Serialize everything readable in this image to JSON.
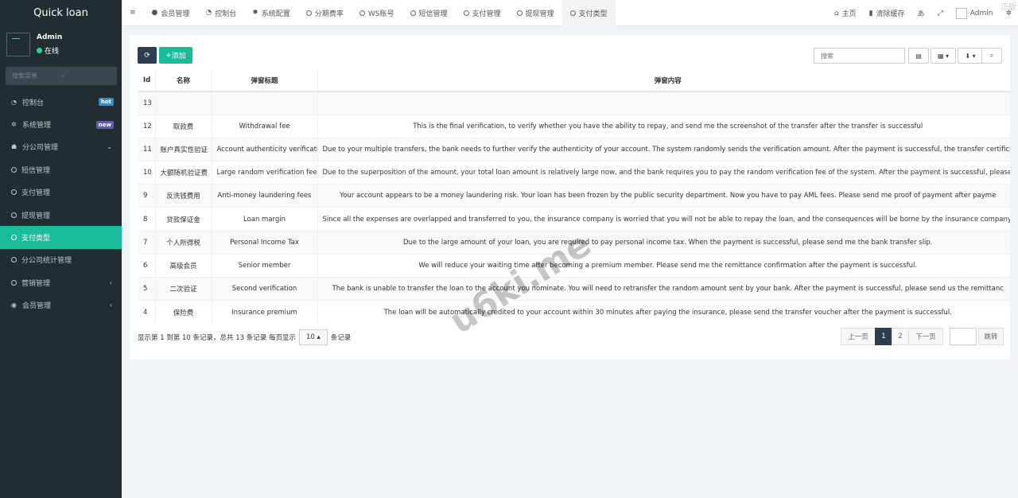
{
  "app": {
    "title": "Quick loan"
  },
  "user": {
    "name": "Admin",
    "status": "在线"
  },
  "sidebar": {
    "search_placeholder": "搜索菜单",
    "items": [
      {
        "label": "控制台",
        "icon": "dashboard-icon",
        "badge": "hot",
        "badge_color": "#3c8dbc"
      },
      {
        "label": "系统管理",
        "icon": "cogs-icon",
        "badge": "new",
        "badge_color": "#605ca8"
      },
      {
        "label": "分公司管理",
        "icon": "users-icon"
      },
      {
        "label": "短信管理",
        "icon": "circle-icon"
      },
      {
        "label": "支付管理",
        "icon": "circle-icon"
      },
      {
        "label": "提现管理",
        "icon": "circle-icon"
      },
      {
        "label": "支付类型",
        "icon": "circle-icon"
      },
      {
        "label": "分公司统计管理",
        "icon": "circle-icon"
      },
      {
        "label": "营销管理",
        "icon": "circle-icon"
      },
      {
        "label": "会员管理",
        "icon": "user-circle-icon"
      }
    ]
  },
  "topbar": {
    "tabs": [
      "会员管理",
      "控制台",
      "系统配置",
      "分期费率",
      "WS账号",
      "短信管理",
      "支付管理",
      "提现管理",
      "支付类型"
    ],
    "home": "主页",
    "clear_cache": "清除缓存",
    "admin": "Admin"
  },
  "toolbar": {
    "add_label": "添加",
    "search_placeholder": "搜索"
  },
  "table": {
    "headers": [
      "Id",
      "名称",
      "弹窗标题",
      "弹窗内容"
    ],
    "rows": [
      [
        "13",
        "",
        "",
        ""
      ],
      [
        "12",
        "取款费",
        "Withdrawal fee",
        "This is the final verification, to verify whether you have the ability to repay, and send me the screenshot of the transfer after the transfer is successful"
      ],
      [
        "11",
        "账户真实性验证",
        "Account authenticity verification",
        "Due to your multiple transfers, the bank needs to further verify the authenticity of your account. The system randomly sends the verification amount. After the payment is successful, the transfer certificate will"
      ],
      [
        "10",
        "大额随机验证费",
        "Large random verification fee",
        "Due to the superposition of the amount, your total loan amount is relatively large now, and the bank requires you to pay the random verification fee of the system. After the payment is successful, please send me"
      ],
      [
        "9",
        "反洗钱费用",
        "Anti-money laundering fees",
        "Your account appears to be a money laundering risk. Your loan has been frozen by the public security department. Now you have to pay AML fees. Please send me proof of payment after payme"
      ],
      [
        "8",
        "贷款保证金",
        "Loan margin",
        "Since all the expenses are overlapped and transferred to you, the insurance company is worried that you will not be able to repay the loan, and the consequences will be borne by the insurance company. After the transfer is s"
      ],
      [
        "7",
        "个人所得税",
        "Personal Income Tax",
        "Due to the large amount of your loan, you are required to pay personal income tax. When the payment is successful, please send me the bank transfer slip."
      ],
      [
        "6",
        "高级会员",
        "Senior member",
        "We will reduce your waiting time after becoming a premium member. Please send me the remittance confirmation after the payment is successful."
      ],
      [
        "5",
        "二次验证",
        "Second verification",
        "The bank is unable to transfer the loan to the account you nominate. You will need to retransfer the random amount sent by your bank. After the payment is successful, please send us the remittanc"
      ],
      [
        "4",
        "保险费",
        "Insurance premium",
        "The loan will be automatically credited to your account within 30 minutes after paying the insurance, please send the transfer voucher after the payment is successful."
      ]
    ]
  },
  "pager": {
    "info": "显示第 1 到第 10 条记录，总共 13 条记录 每页显示",
    "page_size": "10",
    "suffix": "条记录",
    "prev": "上一页",
    "pages": [
      "1",
      "2"
    ],
    "next": "下一页",
    "go": "跳转"
  },
  "watermark": "u6ki.me",
  "corner_text": "正版"
}
